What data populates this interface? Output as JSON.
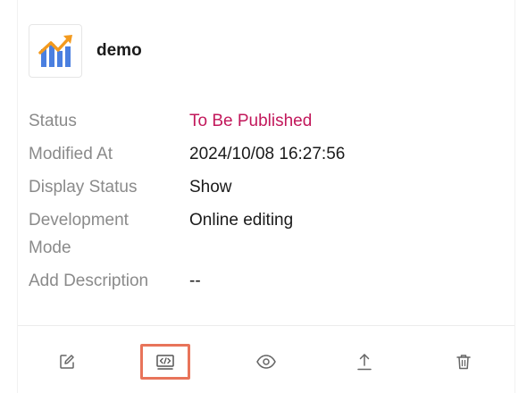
{
  "app": {
    "name": "demo",
    "icon": "chart-trend-icon",
    "icon_colors": {
      "bars": "#4a7fe0",
      "arrow": "#f39a1e"
    }
  },
  "details": [
    {
      "label": "Status",
      "value": "To Be Published",
      "value_color": "#c2185b"
    },
    {
      "label": "Modified At",
      "value": "2024/10/08 16:27:56"
    },
    {
      "label": "Display Status",
      "value": "Show"
    },
    {
      "label_line1": "Development",
      "label_line2": "Mode",
      "value": "Online editing"
    },
    {
      "label": "Add Description",
      "value": "--"
    }
  ],
  "actions": [
    {
      "name": "edit",
      "icon": "edit-icon"
    },
    {
      "name": "code",
      "icon": "code-icon",
      "highlighted": true,
      "highlight_color": "#e8745a"
    },
    {
      "name": "preview",
      "icon": "eye-icon"
    },
    {
      "name": "publish",
      "icon": "upload-icon"
    },
    {
      "name": "delete",
      "icon": "trash-icon"
    }
  ]
}
